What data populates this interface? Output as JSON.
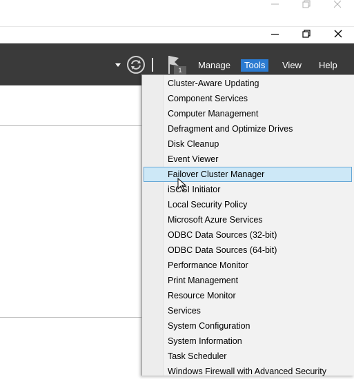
{
  "toolbar": {
    "notification_count": "1",
    "menus": [
      {
        "label": "Manage"
      },
      {
        "label": "Tools"
      },
      {
        "label": "View"
      },
      {
        "label": "Help"
      }
    ]
  },
  "tools_menu": {
    "items": [
      {
        "label": "Cluster-Aware Updating"
      },
      {
        "label": "Component Services"
      },
      {
        "label": "Computer Management"
      },
      {
        "label": "Defragment and Optimize Drives"
      },
      {
        "label": "Disk Cleanup"
      },
      {
        "label": "Event Viewer"
      },
      {
        "label": "Failover Cluster Manager"
      },
      {
        "label": "iSCSI Initiator"
      },
      {
        "label": "Local Security Policy"
      },
      {
        "label": "Microsoft Azure Services"
      },
      {
        "label": "ODBC Data Sources (32-bit)"
      },
      {
        "label": "ODBC Data Sources (64-bit)"
      },
      {
        "label": "Performance Monitor"
      },
      {
        "label": "Print Management"
      },
      {
        "label": "Resource Monitor"
      },
      {
        "label": "Services"
      },
      {
        "label": "System Configuration"
      },
      {
        "label": "System Information"
      },
      {
        "label": "Task Scheduler"
      },
      {
        "label": "Windows Firewall with Advanced Security"
      }
    ],
    "hovered": "Failover Cluster Manager"
  },
  "colors": {
    "toolbar_bg": "#3a3a3a",
    "active_menu": "#2b7bd1",
    "hover_item_bg": "#cde8f7",
    "hover_item_border": "#66a7d6"
  }
}
